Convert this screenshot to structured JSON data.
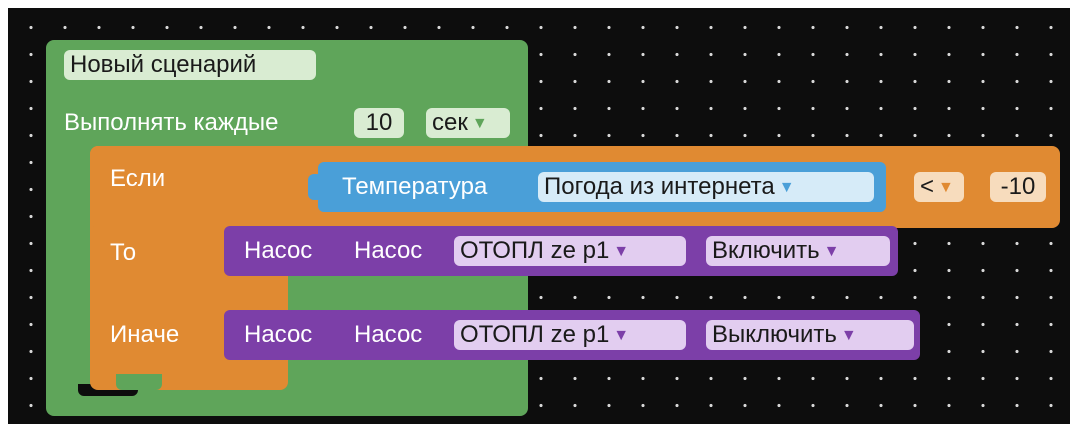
{
  "scenario": {
    "title": "Новый сценарий",
    "repeat_label": "Выполнять каждые",
    "interval_value": "10",
    "interval_unit": "сек"
  },
  "if_block": {
    "if_label": "Если",
    "then_label": "То",
    "else_label": "Иначе"
  },
  "condition": {
    "sensor_label": "Температура",
    "source": "Погода из интернета",
    "operator": "<",
    "value": "-10"
  },
  "then_action": {
    "type_label": "Насос",
    "device_label": "Насос",
    "device": "ОТОПЛ ze p1",
    "action": "Включить"
  },
  "else_action": {
    "type_label": "Насос",
    "device_label": "Насос",
    "device": "ОТОПЛ ze p1",
    "action": "Выключить"
  },
  "colors": {
    "scenario": "#5fa55a",
    "logic": "#e08a32",
    "sensor": "#4a9fd8",
    "device": "#7c3fa8",
    "background": "#0d0d0d"
  }
}
